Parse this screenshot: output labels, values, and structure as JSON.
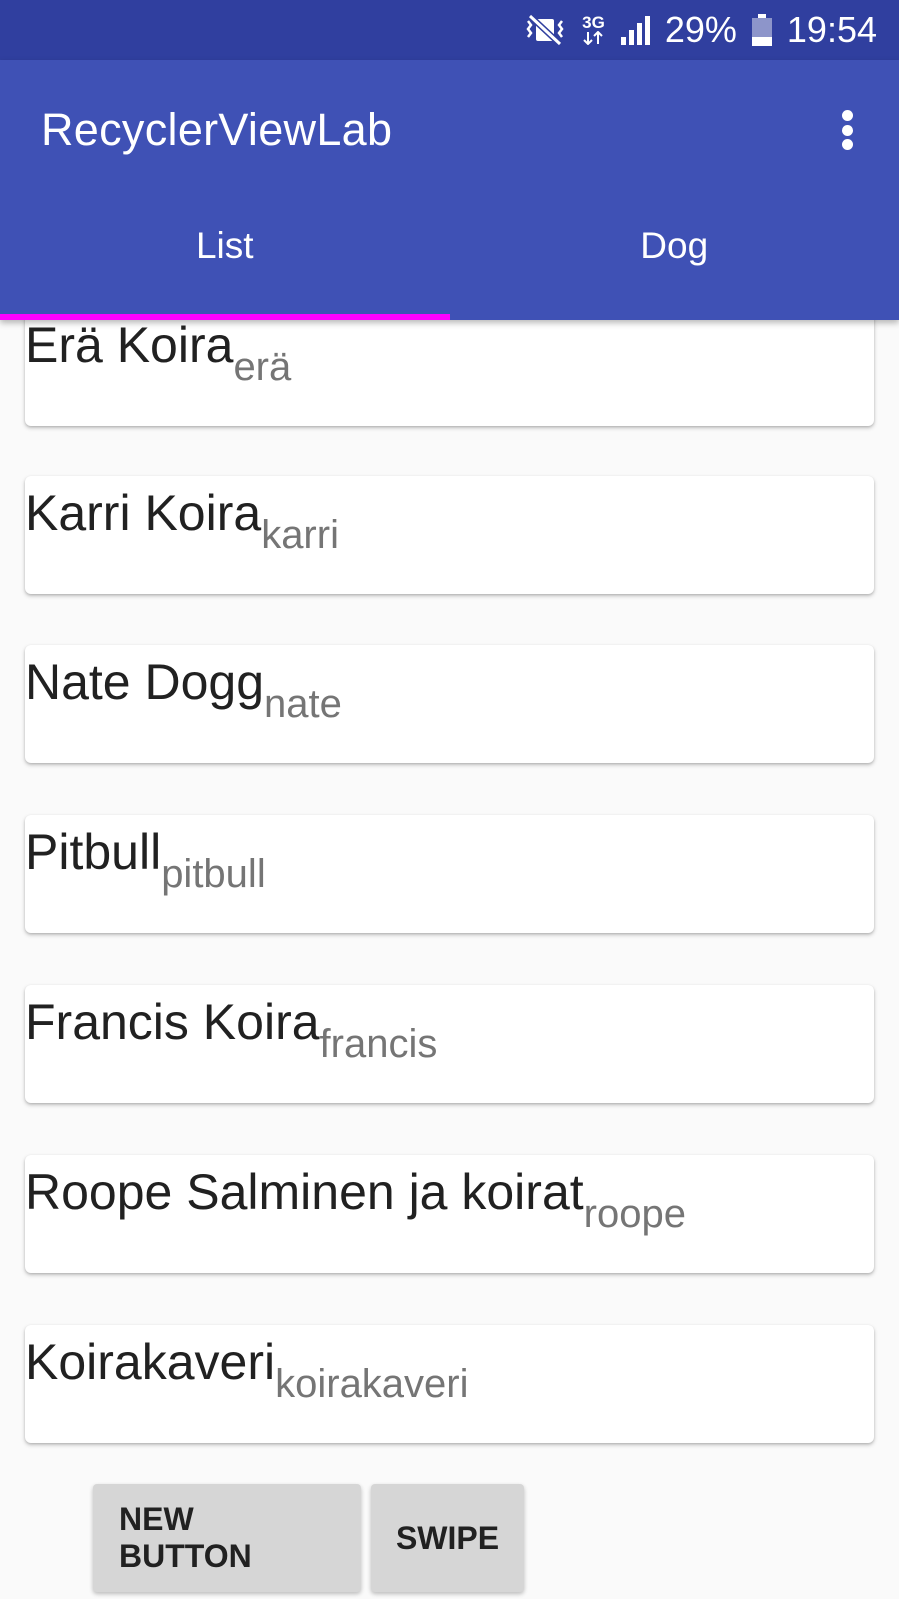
{
  "status_bar": {
    "network_type": "3G",
    "battery_percent": "29%",
    "time": "19:54",
    "icons": [
      "vibrate-icon",
      "network-3g-icon",
      "signal-icon",
      "battery-icon"
    ],
    "background": "#303f9f"
  },
  "app_bar": {
    "title": "RecyclerViewLab",
    "background": "#3f51b5",
    "menu_icon": "more-vert-icon"
  },
  "tabs": [
    {
      "label": "List",
      "selected": true
    },
    {
      "label": "Dog",
      "selected": false
    }
  ],
  "tab_indicator_color": "#ff00ff",
  "items": [
    {
      "name": "Erä Koira",
      "sub": "erä"
    },
    {
      "name": "Karri Koira",
      "sub": "karri"
    },
    {
      "name": "Nate Dogg",
      "sub": "nate"
    },
    {
      "name": "Pitbull",
      "sub": "pitbull"
    },
    {
      "name": "Francis Koira",
      "sub": "francis"
    },
    {
      "name": "Roope Salminen ja koirat",
      "sub": "roope"
    },
    {
      "name": "Koirakaveri",
      "sub": "koirakaveri"
    }
  ],
  "buttons": {
    "new_button": "NEW BUTTON",
    "swipe": "SWIPE"
  }
}
